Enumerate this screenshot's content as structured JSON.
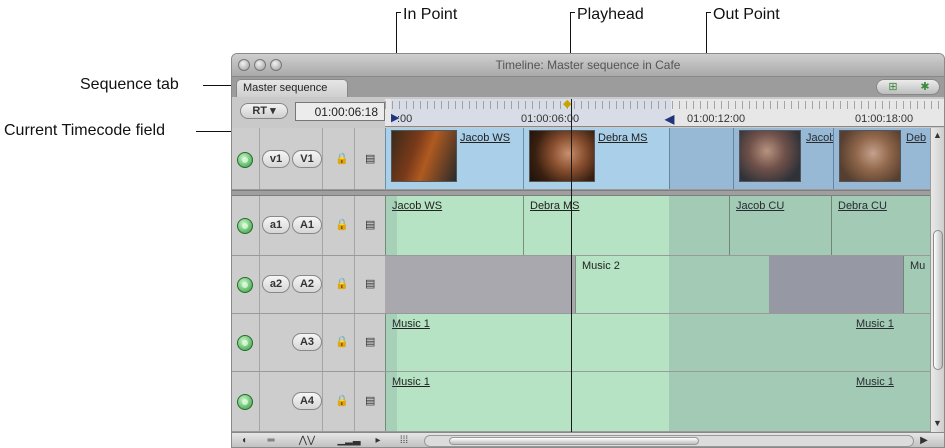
{
  "callouts": {
    "in_point": "In Point",
    "playhead": "Playhead",
    "out_point": "Out Point",
    "sequence_tab": "Sequence tab",
    "current_timecode": "Current Timecode field"
  },
  "window": {
    "title": "Timeline: Master sequence in Cafe",
    "tab": "Master sequence",
    "rt_button": "RT",
    "rt_arrow": "▾",
    "timecode": "01:00:06:18"
  },
  "ruler": {
    "labels": [
      ":00",
      "01:00:06:00",
      "01:00:12:00",
      "01:00:18:00"
    ]
  },
  "tracks": {
    "v1": {
      "source": "v1",
      "dest": "V1",
      "clips": [
        "Jacob WS",
        "Debra MS",
        "Jacob",
        "Deb"
      ]
    },
    "a1": {
      "source": "a1",
      "dest": "A1",
      "clips": [
        "Jacob WS",
        "Debra MS",
        "Jacob CU",
        "Debra CU"
      ]
    },
    "a2": {
      "source": "a2",
      "dest": "A2",
      "clips": [
        "Music 2",
        "Mu"
      ]
    },
    "a3": {
      "dest": "A3",
      "clips": [
        "Music 1",
        "Music 1"
      ]
    },
    "a4": {
      "dest": "A4",
      "clips": [
        "Music 1",
        "Music 1"
      ]
    }
  },
  "icons": {
    "lock": "🔒",
    "sync": "▤",
    "in_marker": "▶",
    "out_marker": "◀",
    "playhead_marker": "◆"
  },
  "colors": {
    "video_clip": "#a9cfe9",
    "audio_clip": "#b6e3c3",
    "toggle_on": "#2f9a3b",
    "playhead": "#1a1a1a"
  }
}
